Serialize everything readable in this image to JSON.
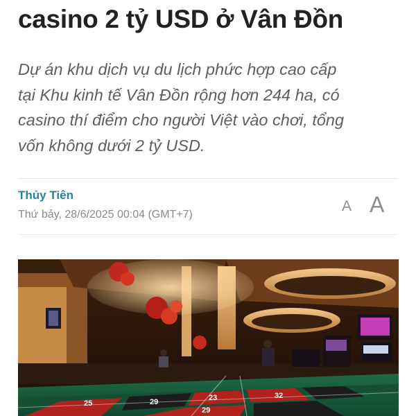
{
  "article": {
    "title_line": "casino 2 tỷ USD ở Vân Đồn",
    "lead": [
      "Dự án khu dịch vụ du lịch phức hợp cao cấp",
      "tại Khu kinh tế Vân Đồn rộng hơn 244 ha, có",
      "casino thí điểm cho người Việt vào chơi, tổng",
      "vốn không dưới 2 tỷ USD."
    ],
    "author": "Thủy Tiên",
    "datetime": "Thứ bảy, 28/6/2025 00:04 (GMT+7)",
    "font_small_label": "A",
    "font_large_label": "A"
  },
  "photo": {
    "roulette_numbers": [
      "25",
      "29",
      "23",
      "29",
      "32"
    ]
  },
  "colors": {
    "author": "#2a7fa1",
    "headline": "#222222",
    "lead": "#5e5e5e"
  }
}
